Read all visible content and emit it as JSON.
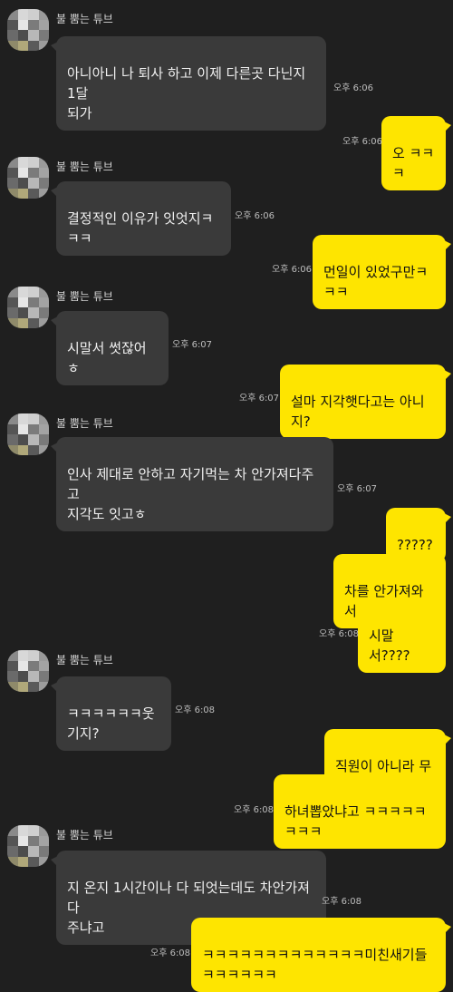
{
  "sender": "불 뿜는 튜브",
  "messages": [
    {
      "from": "them",
      "text": "아니아니 나 퇴사 하고 이제 다른곳 다닌지 1달\n되가",
      "time": "오후 6:06"
    },
    {
      "from": "me",
      "text": "오 ㅋㅋㅋ",
      "time": "오후 6:06"
    },
    {
      "from": "them",
      "text": "결정적인 이유가 잇엇지ㅋㅋㅋ",
      "time": "오후 6:06"
    },
    {
      "from": "me",
      "text": "먼일이 있었구만ㅋㅋㅋ",
      "time": "오후 6:06"
    },
    {
      "from": "them",
      "text": "시말서 썻잖어ㅎ",
      "time": "오후 6:07"
    },
    {
      "from": "me",
      "text": "설마 지각햇다고는 아니지?",
      "time": "오후 6:07"
    },
    {
      "from": "them",
      "text": "인사 제대로 안하고 자기먹는 차 안가져다주고\n지각도 잇고ㅎ",
      "time": "오후 6:07"
    },
    {
      "from": "me",
      "text": "?????",
      "time": ""
    },
    {
      "from": "me",
      "text": "차를 안가져와서",
      "time": ""
    },
    {
      "from": "me",
      "text": "시말서????",
      "time": "오후 6:08"
    },
    {
      "from": "them",
      "text": "ㅋㅋㅋㅋㅋㅋ웃기지?",
      "time": "오후 6:08"
    },
    {
      "from": "me",
      "text": "직원이 아니라 무슨",
      "time": ""
    },
    {
      "from": "me",
      "text": "하녀뽑았냐고 ㅋㅋㅋㅋㅋㅋㅋㅋ",
      "time": "오후 6:08"
    },
    {
      "from": "them",
      "text": "지 온지 1시간이나 다 되엇는데도 차안가져다\n주냐고",
      "time": "오후 6:08"
    },
    {
      "from": "me",
      "text": "ㅋㅋㅋㅋㅋㅋㅋㅋㅋㅋㅋㅋㅋ미친새기들ㅋㅋㅋㅋㅋㅋ",
      "time": "오후 6:08"
    }
  ]
}
